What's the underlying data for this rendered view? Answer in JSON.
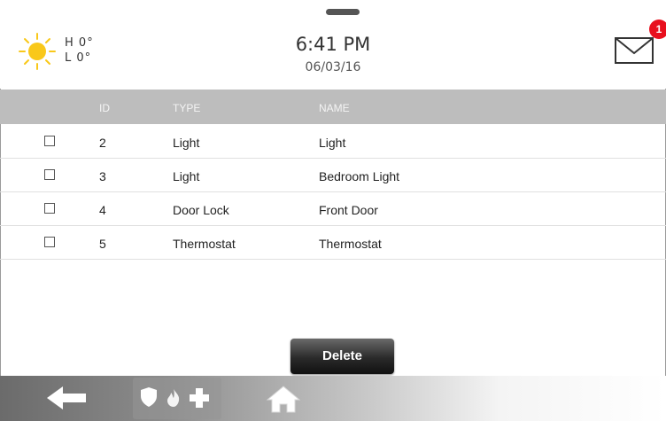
{
  "header": {
    "weather": {
      "high_label": "H",
      "high_value": "0°",
      "low_label": "L",
      "low_value": "0°",
      "icon": "sun-icon"
    },
    "time": "6:41 PM",
    "date": "06/03/16",
    "messages": {
      "icon": "envelope-icon",
      "unread_count": "1"
    }
  },
  "table": {
    "columns": {
      "id": "ID",
      "type": "TYPE",
      "name": "NAME"
    },
    "rows": [
      {
        "id": "2",
        "type": "Light",
        "name": "Light",
        "checked": false
      },
      {
        "id": "3",
        "type": "Light",
        "name": "Bedroom Light",
        "checked": false
      },
      {
        "id": "4",
        "type": "Door Lock",
        "name": "Front Door",
        "checked": false
      },
      {
        "id": "5",
        "type": "Thermostat",
        "name": "Thermostat",
        "checked": false
      }
    ]
  },
  "actions": {
    "delete_label": "Delete"
  },
  "nav": {
    "items": [
      "back-arrow-icon",
      "shield-icon",
      "fire-icon",
      "plus-icon",
      "home-icon"
    ]
  },
  "colors": {
    "header_bar": "#bdbdbd",
    "badge": "#e8101e",
    "sun": "#f9c81a"
  }
}
